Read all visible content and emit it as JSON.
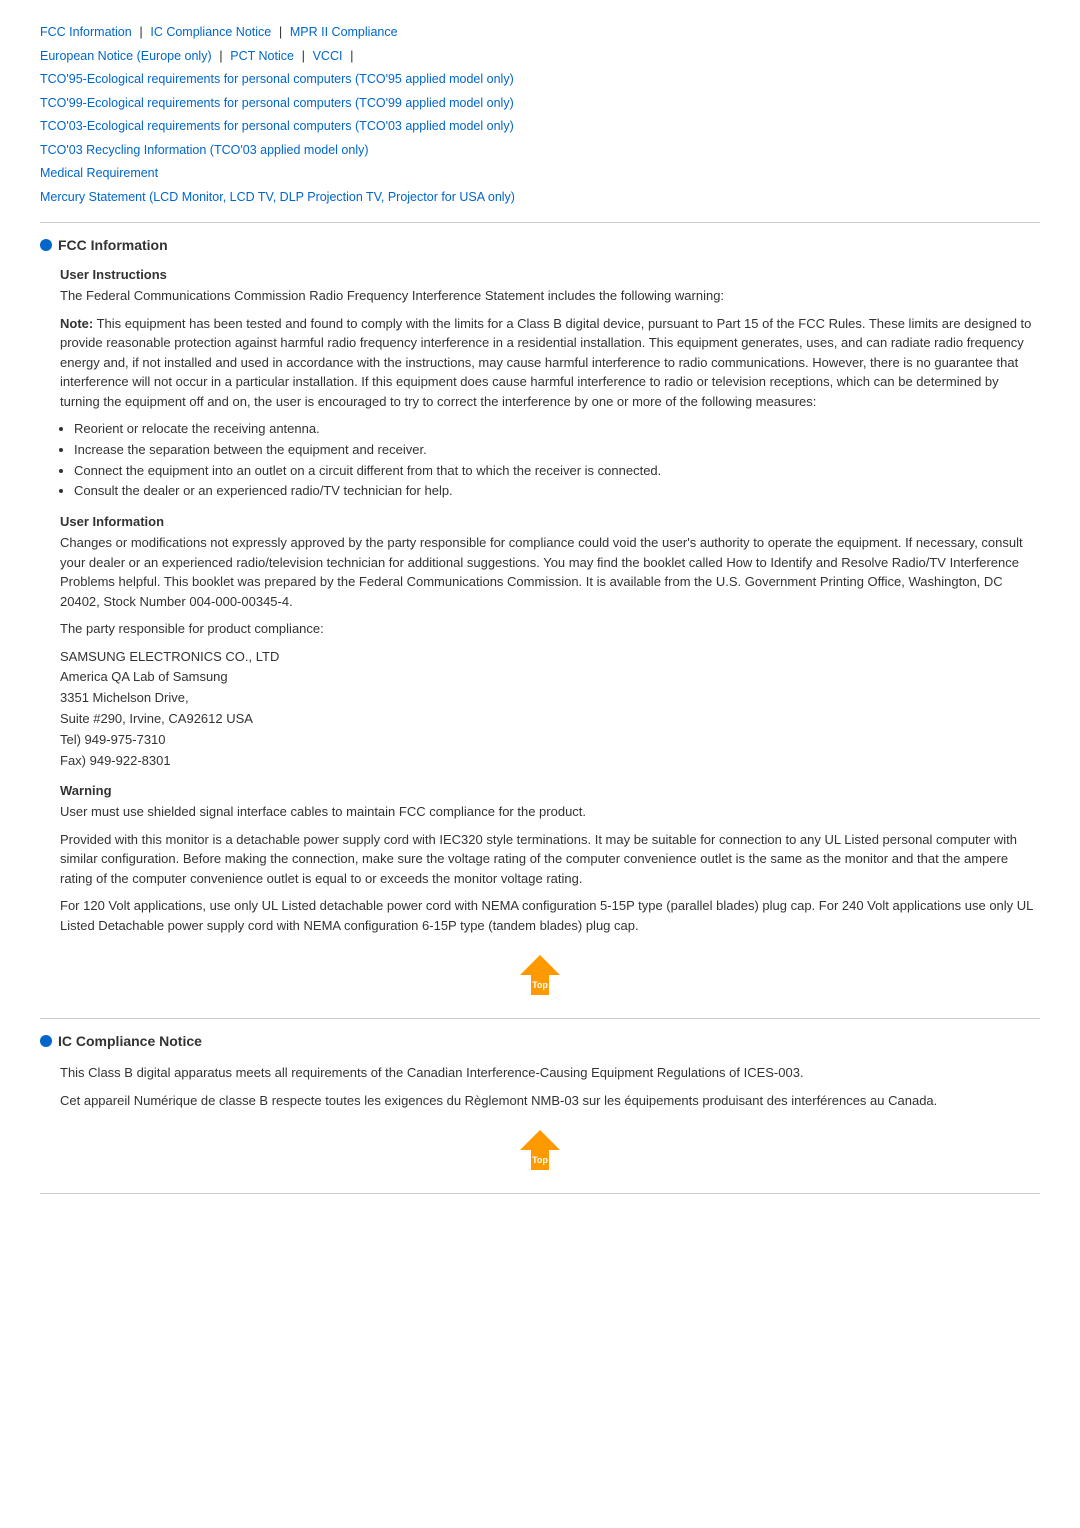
{
  "nav": {
    "links": [
      {
        "label": "FCC Information",
        "id": "fcc-info"
      },
      {
        "label": "IC Compliance Notice",
        "id": "ic-compliance"
      },
      {
        "label": "MPR II Compliance",
        "id": "mpr"
      },
      {
        "label": "European Notice (Europe only)",
        "id": "european"
      },
      {
        "label": "PCT Notice",
        "id": "pct"
      },
      {
        "label": "VCCI",
        "id": "vcci"
      },
      {
        "label": "TCO'95-Ecological requirements for personal computers (TCO'95 applied model only)",
        "id": "tco95"
      },
      {
        "label": "TCO'99-Ecological requirements for personal computers (TCO'99 applied model only)",
        "id": "tco99"
      },
      {
        "label": "TCO'03-Ecological requirements for personal computers (TCO'03 applied model only)",
        "id": "tco03"
      },
      {
        "label": "TCO'03 Recycling Information (TCO'03 applied model only)",
        "id": "tco03r"
      },
      {
        "label": "Medical Requirement",
        "id": "medical"
      },
      {
        "label": "Mercury Statement (LCD Monitor, LCD TV, DLP Projection TV, Projector for USA only)",
        "id": "mercury"
      }
    ]
  },
  "fcc": {
    "title": "FCC Information",
    "user_instructions": {
      "heading": "User Instructions",
      "para1": "The Federal Communications Commission Radio Frequency Interference Statement includes the following warning:",
      "para2_bold": "Note:",
      "para2": " This equipment has been tested and found to comply with the limits for a Class B digital device, pursuant to Part 15 of the FCC Rules. These limits are designed to provide reasonable protection against harmful radio frequency interference in a residential installation. This equipment generates, uses, and can radiate radio frequency energy and, if not installed and used in accordance with the instructions, may cause harmful interference to radio communications. However, there is no guarantee that interference will not occur in a particular installation. If this equipment does cause harmful interference to radio or television receptions, which can be determined by turning the equipment off and on, the user is encouraged to try to correct the interference by one or more of the following measures:",
      "measures": [
        "Reorient or relocate the receiving antenna.",
        "Increase the separation between the equipment and receiver.",
        "Connect the equipment into an outlet on a circuit different from that to which the receiver is connected.",
        "Consult the dealer or an experienced radio/TV technician for help."
      ]
    },
    "user_information": {
      "heading": "User Information",
      "para1": "Changes or modifications not expressly approved by the party responsible for compliance could void the user's authority to operate the equipment. If necessary, consult your dealer or an experienced radio/television technician for additional suggestions. You may find the booklet called How to Identify and Resolve Radio/TV Interference Problems helpful. This booklet was prepared by the Federal Communications Commission. It is available from the U.S. Government Printing Office, Washington, DC 20402, Stock Number 004-000-00345-4.",
      "para2": "The party responsible for product compliance:",
      "company": "SAMSUNG ELECTRONICS CO., LTD\nAmerica QA Lab of Samsung\n3351 Michelson Drive,\nSuite #290, Irvine, CA92612 USA\nTel) 949-975-7310\nFax) 949-922-8301"
    },
    "warning": {
      "heading": "Warning",
      "para1": "User must use shielded signal interface cables to maintain FCC compliance for the product.",
      "para2": "Provided with this monitor is a detachable power supply cord with IEC320 style terminations. It may be suitable for connection to any UL Listed personal computer with similar configuration. Before making the connection, make sure the voltage rating of the computer convenience outlet is the same as the monitor and that the ampere rating of the computer convenience outlet is equal to or exceeds the monitor voltage rating.",
      "para3": "For 120 Volt applications, use only UL Listed detachable power cord with NEMA configuration 5-15P type (parallel blades) plug cap. For 240 Volt applications use only UL Listed Detachable power supply cord with NEMA configuration 6-15P type (tandem blades) plug cap."
    }
  },
  "ic": {
    "title": "IC Compliance Notice",
    "para1": "This Class B digital apparatus meets all requirements of the Canadian Interference-Causing Equipment Regulations of ICES-003.",
    "para2": "Cet appareil Numérique de classe B respecte toutes les exigences du Règlemont NMB-03 sur les équipements produisant des interférences au Canada."
  },
  "top_button_label": "Top"
}
